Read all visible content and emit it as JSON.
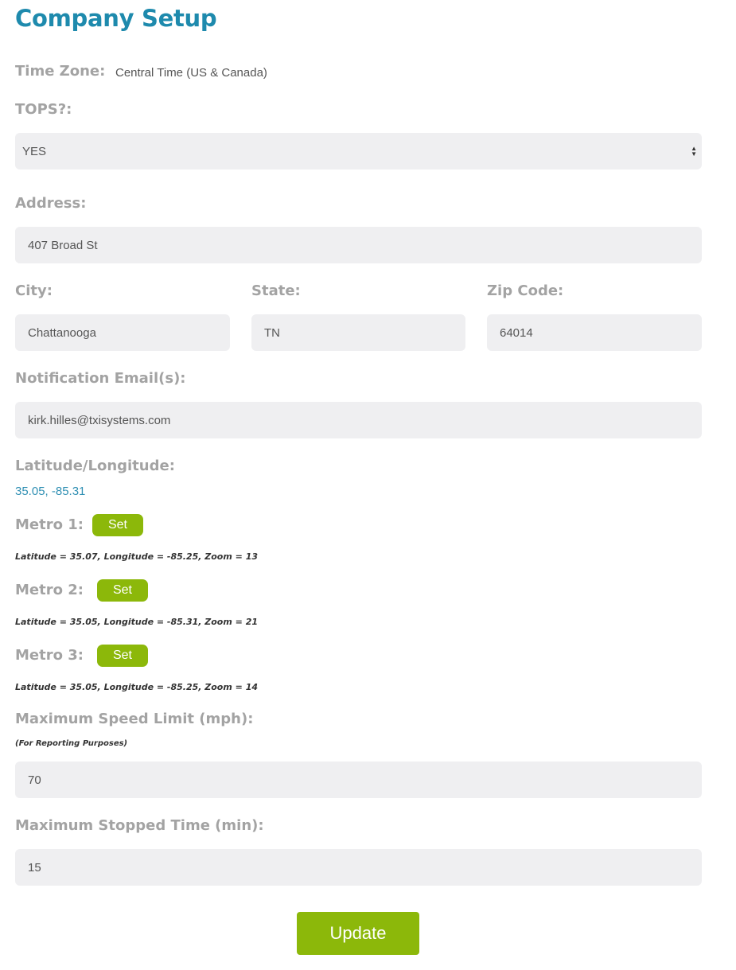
{
  "page": {
    "title": "Company Setup"
  },
  "time_zone": {
    "label": "Time Zone:",
    "value": "Central Time (US & Canada)"
  },
  "tops": {
    "label": "TOPS?:",
    "selected": "YES"
  },
  "address": {
    "label": "Address:",
    "value": "407 Broad St"
  },
  "city": {
    "label": "City:",
    "value": "Chattanooga"
  },
  "state": {
    "label": "State:",
    "value": "TN"
  },
  "zip": {
    "label": "Zip Code:",
    "value": "64014"
  },
  "notification": {
    "label": "Notification Email(s):",
    "value": "kirk.hilles@txisystems.com"
  },
  "latlng": {
    "label": "Latitude/Longitude:",
    "value": "35.05, -85.31"
  },
  "metros": [
    {
      "label": "Metro 1:",
      "button": "Set",
      "info": "Latitude = 35.07, Longitude = -85.25, Zoom = 13"
    },
    {
      "label": "Metro 2:",
      "button": "Set",
      "info": "Latitude = 35.05, Longitude = -85.31, Zoom = 21"
    },
    {
      "label": "Metro 3:",
      "button": "Set",
      "info": "Latitude = 35.05, Longitude = -85.25, Zoom = 14"
    }
  ],
  "max_speed": {
    "label": "Maximum Speed Limit (mph):",
    "note": "(For Reporting Purposes)",
    "value": "70"
  },
  "max_stopped": {
    "label": "Maximum Stopped Time (min):",
    "value": "15"
  },
  "actions": {
    "update_label": "Update"
  },
  "colors": {
    "title": "#1e8aad",
    "label": "#a3a3a3",
    "accent_green": "#8cb80a",
    "field_bg": "#efeff1",
    "link": "#2f8fb3"
  },
  "icons": {
    "select_arrows": "sort-arrows-icon"
  }
}
